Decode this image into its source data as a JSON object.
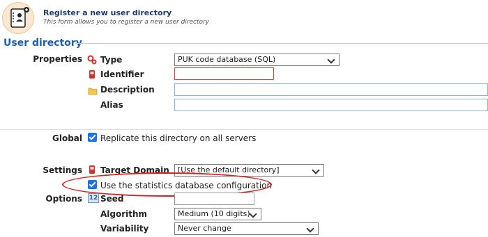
{
  "header": {
    "title": "Register a new user directory",
    "subtitle": "This form allows you to register a new user directory",
    "icon": "user-directory-icon",
    "accent": "#1f5ea8"
  },
  "section": {
    "title": "User directory"
  },
  "properties": {
    "label": "Properties",
    "type": {
      "label": "Type",
      "value": "PUK code database (SQL)",
      "icon": "gear-icon"
    },
    "identifier": {
      "label": "Identifier",
      "value": "",
      "icon": "phone-icon"
    },
    "description": {
      "label": "Description",
      "value": "",
      "icon": "folder-icon"
    },
    "alias": {
      "label": "Alias",
      "value": ""
    }
  },
  "global": {
    "label": "Global",
    "replicate": {
      "label": "Replicate this directory on all servers",
      "checked": true
    }
  },
  "settings": {
    "label": "Settings",
    "target_domain": {
      "label": "Target Domain",
      "value": "[Use the default directory]",
      "icon": "phone-icon"
    },
    "use_statistics": {
      "label": "Use the statistics database configuration",
      "checked": true
    }
  },
  "options": {
    "label": "Options",
    "seed": {
      "label": "Seed",
      "value": "",
      "icon": "number-icon",
      "icon_text": "12"
    },
    "algorithm": {
      "label": "Algorithm",
      "value": "Medium (10 digits)"
    },
    "variability": {
      "label": "Variability",
      "value": "Never change"
    }
  }
}
